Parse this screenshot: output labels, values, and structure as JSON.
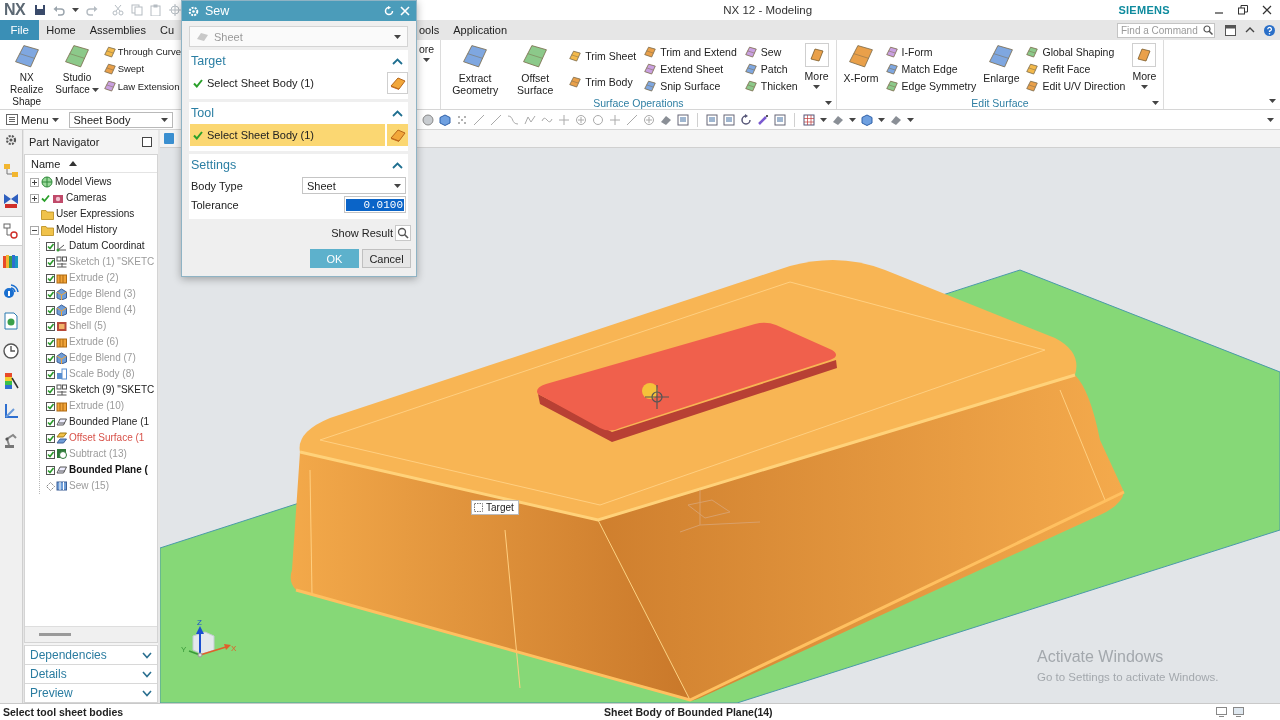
{
  "title_bar": {
    "logo": "NX",
    "title": "NX 12 - Modeling",
    "brand": "SIEMENS"
  },
  "tab_bar": {
    "file_button": "File",
    "tabs": [
      {
        "label": "Home",
        "selected": false
      },
      {
        "label": "Assemblies",
        "selected": false
      },
      {
        "label": "Cu",
        "selected": false
      }
    ],
    "tabs_right": [
      {
        "label": "ools",
        "selected": false
      },
      {
        "label": "Application",
        "selected": false
      }
    ],
    "command_search": {
      "placeholder": "Find a Command"
    }
  },
  "ribbon": {
    "left_items": [
      {
        "kind": "large",
        "label": "NX Realize Shape",
        "menu": false
      },
      {
        "kind": "large",
        "label": "Studio Surface",
        "menu": true
      },
      {
        "kind": "stack",
        "commands": [
          "Through Curve",
          "Swept",
          "Law Extension"
        ]
      }
    ],
    "cut_button": {
      "label": "ore",
      "menu": true
    },
    "groups": [
      {
        "label": "Surface Operations",
        "items": [
          {
            "kind": "large",
            "label": "Extract Geometry",
            "menu": false
          },
          {
            "kind": "large",
            "label": "Offset Surface",
            "menu": false
          },
          {
            "kind": "stack",
            "commands": [
              "Trim Sheet",
              "Trim Body"
            ]
          },
          {
            "kind": "stack",
            "commands": [
              "Trim and Extend",
              "Extend Sheet",
              "Snip Surface"
            ]
          },
          {
            "kind": "stack",
            "commands": [
              "Sew",
              "Patch",
              "Thicken"
            ]
          },
          {
            "kind": "more",
            "label": "More",
            "menu": true
          }
        ]
      },
      {
        "label": "Edit Surface",
        "items": [
          {
            "kind": "large",
            "label": "X-Form",
            "menu": false
          },
          {
            "kind": "stack",
            "commands": [
              "I-Form",
              "Match Edge",
              "Edge Symmetry"
            ]
          },
          {
            "kind": "large",
            "label": "Enlarge",
            "menu": false
          },
          {
            "kind": "stack",
            "commands": [
              "Global Shaping",
              "Refit Face",
              "Edit U/V Direction"
            ]
          },
          {
            "kind": "more",
            "label": "More",
            "menu": true
          }
        ]
      }
    ]
  },
  "toolbar": {
    "menu_button": "Menu",
    "selection_filter": "Sheet Body"
  },
  "dialog": {
    "title": "Sew",
    "type_selector": {
      "value": "Sheet",
      "disabled": true
    },
    "sections": [
      {
        "title": "Target",
        "expanded": true,
        "kind": "selection",
        "step": {
          "label": "Select Sheet Body (1)",
          "complete": true,
          "selected": false
        }
      },
      {
        "title": "Tool",
        "expanded": true,
        "kind": "selection",
        "step": {
          "label": "Select Sheet Body (1)",
          "complete": true,
          "selected": true
        }
      },
      {
        "title": "Settings",
        "expanded": true,
        "kind": "settings",
        "fields": [
          {
            "kind": "dropdown",
            "label": "Body Type",
            "value": "Sheet"
          },
          {
            "kind": "number",
            "label": "Tolerance",
            "value": "0.0100",
            "text_selected": true
          }
        ]
      }
    ],
    "show_result": "Show Result",
    "buttons": [
      {
        "label": "OK",
        "primary": true
      },
      {
        "label": "Cancel",
        "primary": false
      }
    ]
  },
  "resource_bar": [
    {
      "kind": "assembly",
      "selected": false
    },
    {
      "kind": "constraints",
      "selected": false
    },
    {
      "kind": "part",
      "selected": true
    },
    {
      "kind": "library",
      "selected": false
    },
    {
      "kind": "info",
      "selected": false
    },
    {
      "kind": "browser",
      "selected": false
    },
    {
      "kind": "history",
      "selected": false
    },
    {
      "kind": "process",
      "selected": false
    },
    {
      "kind": "manufacturing",
      "selected": false
    },
    {
      "kind": "roles",
      "selected": false
    }
  ],
  "part_navigator": {
    "title": "Part Navigator",
    "column": "Name",
    "tree": [
      {
        "label": "Model Views",
        "kind": "views",
        "expanded": false
      },
      {
        "label": "Cameras",
        "kind": "cameras",
        "expanded": false,
        "checked": true
      },
      {
        "label": "User Expressions",
        "kind": "folder"
      },
      {
        "label": "Model History",
        "kind": "folder",
        "expanded": true,
        "children": [
          {
            "label": "Datum Coordinat",
            "kind": "datum",
            "checked": true,
            "dimmed": false,
            "highlighted": false,
            "current": false
          },
          {
            "label": "Sketch (1) \"SKETC",
            "kind": "sketch",
            "checked": true,
            "dimmed": true,
            "highlighted": false,
            "current": false
          },
          {
            "label": "Extrude (2)",
            "kind": "extrude",
            "checked": true,
            "dimmed": true,
            "highlighted": false,
            "current": false
          },
          {
            "label": "Edge Blend (3)",
            "kind": "blend",
            "checked": true,
            "dimmed": true,
            "highlighted": false,
            "current": false
          },
          {
            "label": "Edge Blend (4)",
            "kind": "blend",
            "checked": true,
            "dimmed": true,
            "highlighted": false,
            "current": false
          },
          {
            "label": "Shell (5)",
            "kind": "shell",
            "checked": true,
            "dimmed": true,
            "highlighted": false,
            "current": false
          },
          {
            "label": "Extrude (6)",
            "kind": "extrude",
            "checked": true,
            "dimmed": true,
            "highlighted": false,
            "current": false
          },
          {
            "label": "Edge Blend (7)",
            "kind": "blend",
            "checked": true,
            "dimmed": true,
            "highlighted": false,
            "current": false
          },
          {
            "label": "Scale Body (8)",
            "kind": "scale",
            "checked": true,
            "dimmed": true,
            "highlighted": false,
            "current": false
          },
          {
            "label": "Sketch (9) \"SKETC",
            "kind": "sketch",
            "checked": true,
            "dimmed": false,
            "highlighted": false,
            "current": false
          },
          {
            "label": "Extrude (10)",
            "kind": "extrude",
            "checked": true,
            "dimmed": true,
            "highlighted": false,
            "current": false
          },
          {
            "label": "Bounded Plane (1",
            "kind": "plane",
            "checked": true,
            "dimmed": false,
            "highlighted": false,
            "current": false
          },
          {
            "label": "Offset Surface (1",
            "kind": "offset",
            "checked": true,
            "dimmed": false,
            "highlighted": true,
            "current": false
          },
          {
            "label": "Subtract (13)",
            "kind": "subtract",
            "checked": true,
            "dimmed": true,
            "highlighted": false,
            "current": false
          },
          {
            "label": "Bounded Plane (",
            "kind": "plane",
            "checked": true,
            "dimmed": false,
            "highlighted": false,
            "current": true
          },
          {
            "label": "Sew (15)",
            "kind": "sew",
            "checked": false,
            "dimmed": true,
            "highlighted": false,
            "current": false
          }
        ]
      }
    ],
    "panels": [
      {
        "label": "Dependencies",
        "expanded": false
      },
      {
        "label": "Details",
        "expanded": false
      },
      {
        "label": "Preview",
        "expanded": false
      }
    ]
  },
  "viewport": {
    "tag": "Target",
    "axis_labels": {
      "z": "Z",
      "x": "X",
      "y": "Y"
    }
  },
  "os_notice": {
    "title": "Activate Windows",
    "text": "Go to Settings to activate Windows."
  },
  "status_bar": {
    "prompt": "Select tool sheet bodies",
    "selection": "Sheet Body of Bounded Plane(14)"
  }
}
